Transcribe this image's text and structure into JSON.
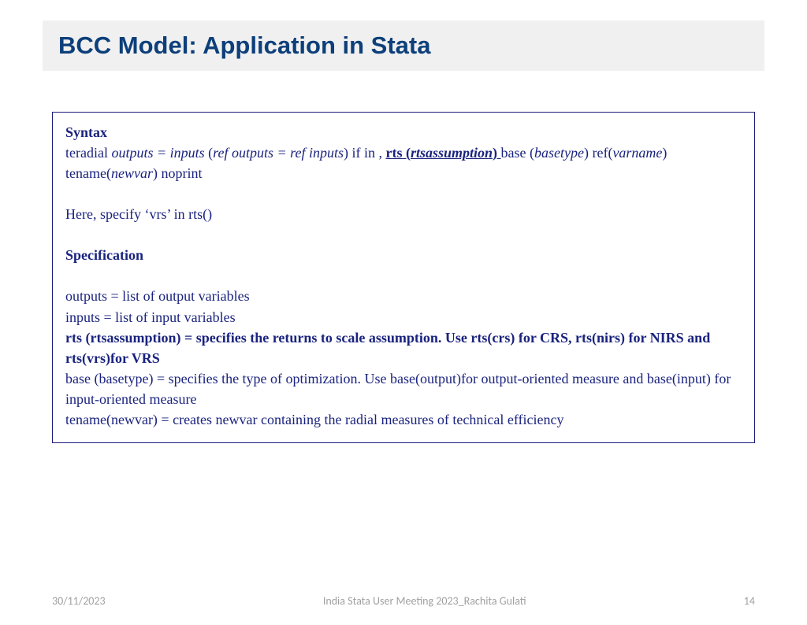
{
  "title": "BCC Model: Application in Stata",
  "syntax": {
    "label": "Syntax",
    "t01": "teradial ",
    "t02": "outputs = inputs ",
    "t03": "(",
    "t04": "ref outputs = ref inputs",
    "t05": ") if in , ",
    "t06": "rts (",
    "t07": "rtsassumption",
    "t08": ") ",
    "t09": "base (",
    "t10": "basetype",
    "t11": ") ref(",
    "t12": "varname",
    "t13": ") tename(",
    "t14": "newvar",
    "t15": ") noprint"
  },
  "note": "Here, specify ‘vrs’ in rts()",
  "spec": {
    "label": "Specification",
    "l1": "outputs = list of output variables",
    "l2": "inputs = list of input variables",
    "l3": "rts (rtsassumption) = specifies the returns to scale assumption. Use rts(crs) for CRS, rts(nirs) for NIRS and rts(vrs)for VRS",
    "l4": "base (basetype) = specifies the type of optimization. Use base(output)for output-oriented measure and base(input) for input-oriented measure",
    "l5": "tename(newvar) = creates newvar containing the radial measures of technical efficiency"
  },
  "footer": {
    "date": "30/11/2023",
    "center": "India Stata User Meeting 2023_Rachita Gulati",
    "page": "14"
  }
}
